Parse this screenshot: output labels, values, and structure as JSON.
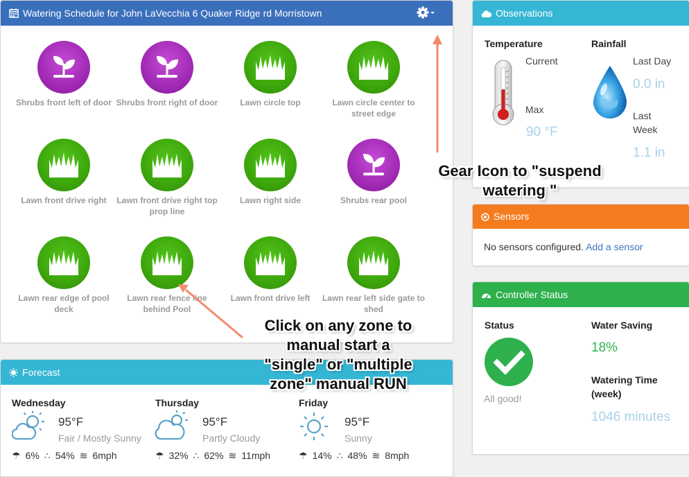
{
  "schedule": {
    "title": "Watering Schedule for John LaVecchia 6 Quaker Ridge rd Morristown",
    "zones": [
      {
        "label": "Shrubs front left of door",
        "type": "shrub"
      },
      {
        "label": "Shrubs front right of door",
        "type": "shrub"
      },
      {
        "label": "Lawn circle top",
        "type": "lawn"
      },
      {
        "label": "Lawn circle center to street edge",
        "type": "lawn"
      },
      {
        "label": "Lawn front drive right",
        "type": "lawn"
      },
      {
        "label": "Lawn front drive right top prop line",
        "type": "lawn"
      },
      {
        "label": "Lawn right side",
        "type": "lawn"
      },
      {
        "label": "Shrubs rear pool",
        "type": "shrub"
      },
      {
        "label": "Lawn rear edge of pool deck",
        "type": "lawn"
      },
      {
        "label": "Lawn rear fence line behind Pool",
        "type": "lawn"
      },
      {
        "label": "Lawn front drive left",
        "type": "lawn"
      },
      {
        "label": "Lawn rear left side gate to shed",
        "type": "lawn"
      }
    ]
  },
  "observations": {
    "title": "Observations",
    "temperature": {
      "heading": "Temperature",
      "current_label": "Current",
      "max_label": "Max",
      "max_value": "90 °F"
    },
    "rainfall": {
      "heading": "Rainfall",
      "last_day_label": "Last Day",
      "last_day_value": "0.0 in",
      "last_week_label_1": "Last",
      "last_week_label_2": "Week",
      "last_week_value": "1.1 in"
    }
  },
  "sensors": {
    "title": "Sensors",
    "message": "No sensors configured.",
    "add_link": "Add a sensor"
  },
  "controller": {
    "title": "Controller Status",
    "status_label": "Status",
    "status_text": "All good!",
    "saving_label": "Water Saving",
    "saving_value": "18%",
    "time_label_1": "Watering Time",
    "time_label_2": "(week)",
    "time_value": "1046 minutes"
  },
  "forecast": {
    "title": "Forecast",
    "days": [
      {
        "name": "Wednesday",
        "temp": "95°F",
        "condition": "Fair / Mostly Sunny",
        "precip": "6%",
        "humidity": "54%",
        "wind": "6mph",
        "icon": "sun-cloud-icon"
      },
      {
        "name": "Thursday",
        "temp": "95°F",
        "condition": "Partly Cloudy",
        "precip": "32%",
        "humidity": "62%",
        "wind": "11mph",
        "icon": "cloud-sun-icon"
      },
      {
        "name": "Friday",
        "temp": "95°F",
        "condition": "Sunny",
        "precip": "14%",
        "humidity": "48%",
        "wind": "8mph",
        "icon": "sun-icon"
      }
    ]
  },
  "annotations": {
    "gear_1": "Gear Icon to \"suspend",
    "gear_2": "watering \"",
    "click_1": "Click on any zone to",
    "click_2": "manual start a",
    "click_3": "\"single\" or \"multiple",
    "click_4": "zone\" manual RUN"
  },
  "colors": {
    "schedule_header": "#3a6fbc",
    "observations_header": "#35b6d4",
    "sensors_header": "#f47b20",
    "controller_header": "#2eb14d",
    "lawn": "#3da60c",
    "shrub": "#a12ab5",
    "annotation_arrow": "#f28a6c"
  }
}
